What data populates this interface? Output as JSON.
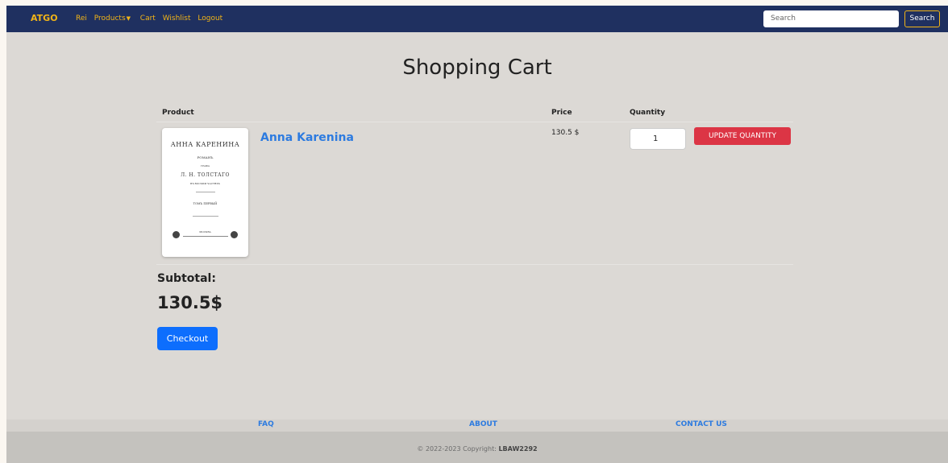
{
  "navbar": {
    "brand": "ATGO",
    "links": [
      "Rei",
      "Products",
      "Cart",
      "Wishlist",
      "Logout"
    ],
    "search_placeholder": "Search",
    "search_button": "Search"
  },
  "page": {
    "title": "Shopping Cart"
  },
  "table": {
    "headers": {
      "product": "Product",
      "price": "Price",
      "quantity": "Quantity"
    },
    "items": [
      {
        "name": "Anna Karenina",
        "price": "130.5 $",
        "quantity": "1",
        "update_label": "UPDATE QUANTITY",
        "cover_text": {
          "title": "АННА КАРЕНИНА",
          "line1": "РОМАНЪ",
          "line2": "ГРАФА",
          "author": "Л. Н. ТОЛСТАГО",
          "line3": "ВЪ ВОСЬМИ ЧАСТЯХЪ",
          "volume": "ТОМЪ ПЕРВЫЙ",
          "city": "МОСКВА"
        }
      }
    ]
  },
  "summary": {
    "subtotal_label": "Subtotal:",
    "subtotal_value": "130.5$",
    "checkout_label": "Checkout"
  },
  "footer": {
    "links": [
      "FAQ",
      "ABOUT",
      "CONTACT US"
    ],
    "copyright_prefix": "© 2022-2023 Copyright: ",
    "copyright_name": "LBAW2292"
  },
  "colors": {
    "navbar": "#1f3060",
    "accent": "#f2b417",
    "link": "#2d7be0",
    "danger": "#dc3545",
    "primary": "#0d6efd"
  }
}
